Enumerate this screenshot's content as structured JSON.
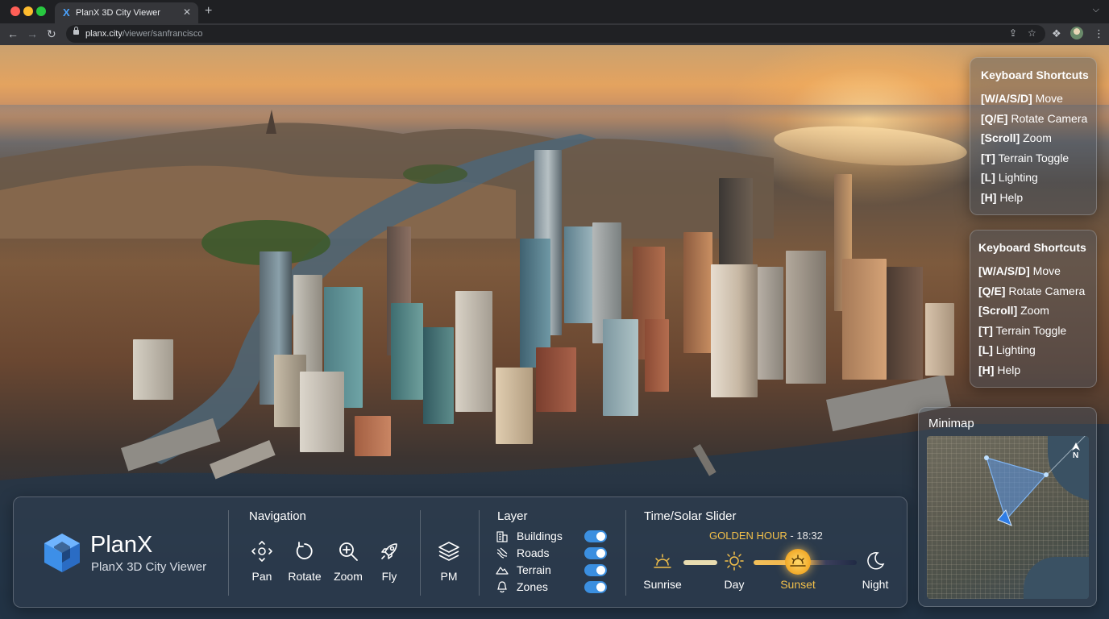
{
  "browser": {
    "tab_title": "PlanX 3D City Viewer",
    "tab_favicon": "X",
    "tab_close": "✕",
    "new_tab": "+",
    "url_host": "planx.city",
    "url_path": "/viewer/sanfrancisco",
    "icons": [
      "back-icon",
      "forward-icon",
      "reload-icon",
      "lock-icon",
      "share-icon",
      "bookmark-star-icon",
      "extensions-icon",
      "profile-avatar",
      "menu-icon",
      "tab-list-icon"
    ]
  },
  "shortcuts_top": {
    "title": "Keyboard Shortcuts",
    "items": [
      {
        "key": "[W/A/S/D]",
        "label": "Move"
      },
      {
        "key": "[Q/E]",
        "label": "Rotate Camera"
      },
      {
        "key": "[Scroll]",
        "label": "Zoom"
      },
      {
        "key": "[T]",
        "label": "Terrain Toggle"
      },
      {
        "key": "[L]",
        "label": "Lighting"
      },
      {
        "key": "[H]",
        "label": "Help"
      }
    ]
  },
  "shortcuts_bottom": {
    "title": "Keyboard Shortcuts",
    "items": [
      {
        "key": "[W/A/S/D]",
        "label": "Move"
      },
      {
        "key": "[Q/E]",
        "label": "Rotate Camera"
      },
      {
        "key": "[Scroll]",
        "label": "Zoom"
      },
      {
        "key": "[T]",
        "label": "Terrain Toggle"
      },
      {
        "key": "[L]",
        "label": "Lighting"
      },
      {
        "key": "[H]",
        "label": "Help"
      }
    ]
  },
  "minimap": {
    "title": "Minimap",
    "north_label": "N"
  },
  "brand": {
    "name": "PlanX",
    "subtitle": "PlanX 3D City Viewer"
  },
  "navigation": {
    "title": "Navigation",
    "items": [
      {
        "label": "Pan",
        "icon": "pan-move-icon"
      },
      {
        "label": "Rotate",
        "icon": "rotate-icon"
      },
      {
        "label": "Zoom",
        "icon": "zoom-icon"
      },
      {
        "label": "Fly",
        "icon": "rocket-icon"
      }
    ],
    "pm_label": "PM",
    "pm_icon": "layers-stack-icon"
  },
  "layers": {
    "title": "Layer",
    "items": [
      {
        "label": "Buildings",
        "icon": "buildings-icon",
        "enabled": true
      },
      {
        "label": "Roads",
        "icon": "roads-icon",
        "enabled": true
      },
      {
        "label": "Terrain",
        "icon": "terrain-icon",
        "enabled": true
      },
      {
        "label": "Zones",
        "icon": "zones-icon",
        "enabled": true
      }
    ]
  },
  "solar": {
    "title": "Time/Solar Slider",
    "phase": "GOLDEN HOUR",
    "time": "- 18:32",
    "stops": [
      "Sunrise",
      "Day",
      "Sunset",
      "Night"
    ],
    "selected": "Sunset",
    "position_fraction": 0.72
  },
  "colors": {
    "accent_blue": "#3b8fe0",
    "golden": "#f4c14a"
  }
}
